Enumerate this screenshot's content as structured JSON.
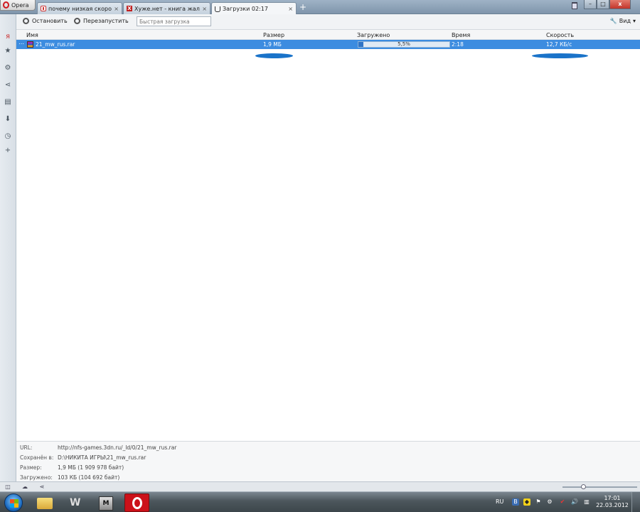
{
  "browser": {
    "menu_label": "Opera",
    "tabs": [
      {
        "title": "почему низкая скоро...",
        "icon": "yandex-favicon"
      },
      {
        "title": "Хуже.нет - книга жало...",
        "icon": "xuzhe-favicon"
      },
      {
        "title": "Загрузки 02:17",
        "icon": "downloads-favicon"
      }
    ],
    "new_tab": "+",
    "close_glyph": "×"
  },
  "toolbar": {
    "stop_label": "Остановить",
    "restart_label": "Перезапустить",
    "quick_placeholder": "Быстрая загрузка",
    "view_label": "Вид"
  },
  "downloads": {
    "columns": [
      "Имя",
      "Размер",
      "Загружено",
      "Время",
      "Скорость"
    ],
    "rows": [
      {
        "name": "21_mw_rus.rar",
        "size": "1,9 МБ",
        "progress_text": "5,5%",
        "progress": 0.055,
        "time": "2:18",
        "speed": "12,7 КБ/с"
      }
    ]
  },
  "details": {
    "url_label": "URL:",
    "url_value": "http://nfs-games.3dn.ru/_ld/0/21_mw_rus.rar",
    "saved_label": "Сохранён в:",
    "saved_value": "D:\\НИКИТА ИГРЫ\\21_mw_rus.rar",
    "size_label": "Размер:",
    "size_value": "1,9 МБ (1 909 978 байт)",
    "loaded_label": "Загружено:",
    "loaded_value": "103 КБ (104 692 байт)"
  },
  "taskbar": {
    "lang": "RU",
    "time": "17:01",
    "date": "22.03.2012"
  },
  "colors": {
    "selection": "#3c8ce0",
    "scribble": "#1a73c9",
    "opera_red": "#cc1119"
  }
}
